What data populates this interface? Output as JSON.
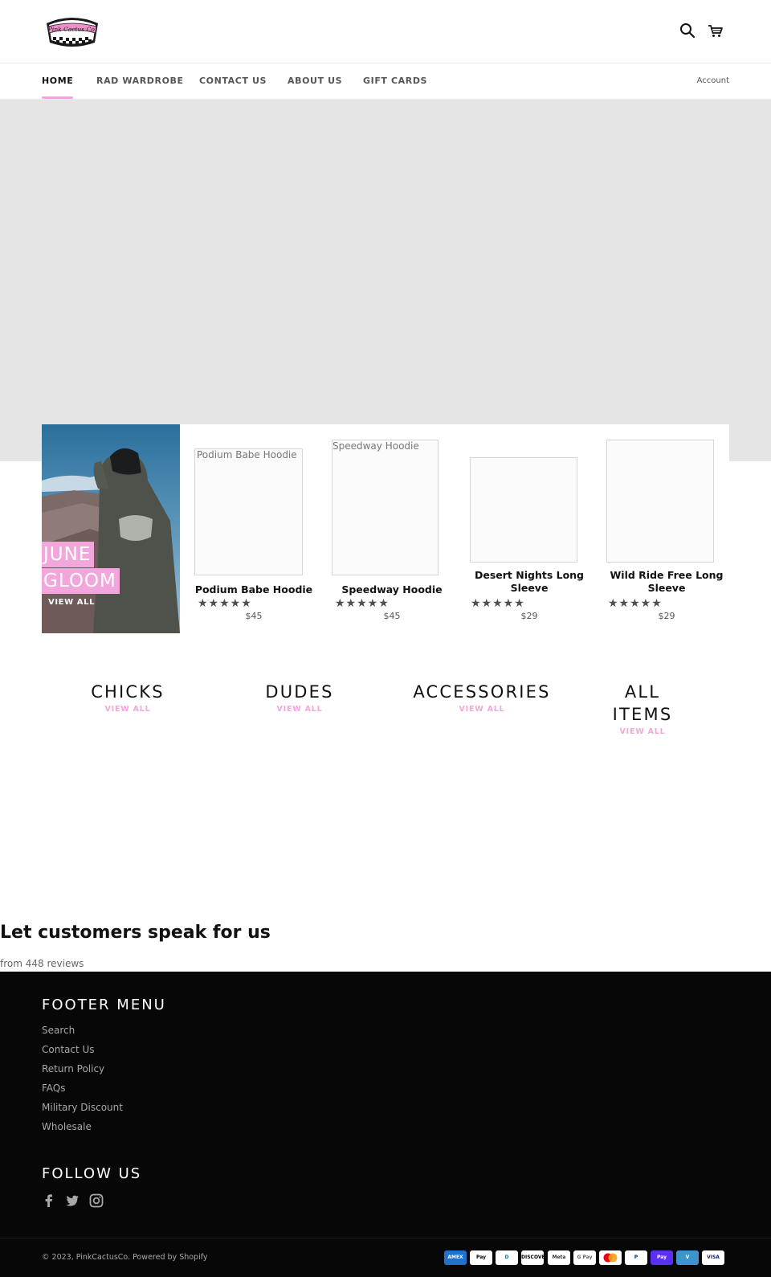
{
  "header": {
    "logo_text": "Pink Cactus Co.",
    "search_icon": "search-icon",
    "cart_icon": "cart-icon"
  },
  "nav": {
    "items": [
      {
        "label": "HOME",
        "active": true
      },
      {
        "label": "RAD WARDROBE"
      },
      {
        "label": "CONTACT US"
      },
      {
        "label": "ABOUT US"
      },
      {
        "label": "GIFT CARDS"
      }
    ],
    "account": "Account"
  },
  "featured": {
    "promo": {
      "line1": "JUNE",
      "line2": "GLOOM",
      "view_all": "VIEW ALL"
    },
    "products": [
      {
        "image_alt": "Podium Babe Hoodie",
        "title": "Podium Babe Hoodie",
        "rating": 5,
        "price": "$45"
      },
      {
        "image_alt": "Speedway Hoodie",
        "title": "Speedway Hoodie",
        "rating": 5,
        "price": "$45"
      },
      {
        "image_alt": "",
        "title_line1": "Desert Nights Long",
        "title_line2": "Sleeve",
        "rating": 5,
        "price": "$29"
      },
      {
        "image_alt": "",
        "title_line1": "Wild Ride Free Long",
        "title_line2": "Sleeve",
        "rating": 5,
        "price": "$29"
      }
    ],
    "stars": "★★★★★"
  },
  "collections": [
    {
      "title": "CHICKS",
      "link": "VIEW ALL"
    },
    {
      "title": "DUDES",
      "link": "VIEW ALL"
    },
    {
      "title": "ACCESSORIES",
      "link": "VIEW ALL"
    },
    {
      "title_line1": "ALL",
      "title_line2": "ITEMS",
      "link": "VIEW ALL"
    }
  ],
  "reviews": {
    "title": "Let customers speak for us",
    "count": "from 448 reviews"
  },
  "footer": {
    "menu_heading": "FOOTER MENU",
    "menu_links": [
      "Search",
      "Contact Us",
      "Return Policy",
      "FAQs",
      "Military Discount",
      "Wholesale"
    ],
    "follow_heading": "FOLLOW US",
    "social": [
      "facebook-icon",
      "twitter-icon",
      "instagram-icon"
    ],
    "copyright": "© 2023, PinkCactusCo. Powered by Shopify",
    "payments": [
      {
        "label": "AMEX",
        "bg": "#1f72cd",
        "fg": "#ffffff"
      },
      {
        "label": "Pay",
        "bg": "#ffffff",
        "fg": "#000000"
      },
      {
        "label": "D",
        "bg": "#ffffff",
        "fg": "#0079be"
      },
      {
        "label": "DISCOVER",
        "bg": "#ffffff",
        "fg": "#000000"
      },
      {
        "label": "Meta",
        "bg": "#ffffff",
        "fg": "#333333"
      },
      {
        "label": "G Pay",
        "bg": "#ffffff",
        "fg": "#5f6368"
      },
      {
        "label": "",
        "bg": "#ffffff",
        "fg": "#eb001b"
      },
      {
        "label": "P",
        "bg": "#ffffff",
        "fg": "#003087"
      },
      {
        "label": "Pay",
        "bg": "#5a31f4",
        "fg": "#ffffff"
      },
      {
        "label": "V",
        "bg": "#3d95ce",
        "fg": "#ffffff"
      },
      {
        "label": "VISA",
        "bg": "#ffffff",
        "fg": "#1a1f71"
      }
    ]
  },
  "colors": {
    "accent": "#f3a6dc",
    "hero_placeholder": "#e5e5e5",
    "footer_bg": "#070707"
  }
}
